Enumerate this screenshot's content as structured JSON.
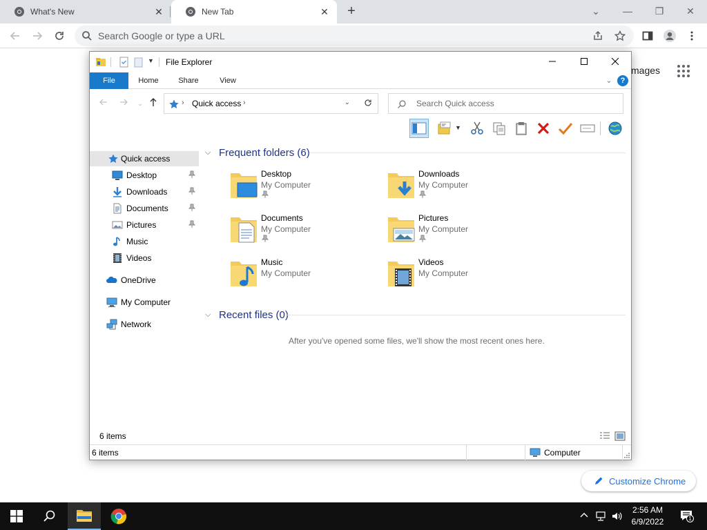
{
  "browser": {
    "tabs": [
      {
        "title": "What's New",
        "close": "✕"
      },
      {
        "title": "New Tab",
        "close": "✕"
      }
    ],
    "new_tab": "+",
    "window_controls": {
      "dropdown": "⌄",
      "minimize": "—",
      "restore": "❐",
      "close": "✕"
    },
    "omnibox_placeholder": "Search Google or type a URL",
    "images_link": "mages",
    "customize_label": "Customize Chrome",
    "accent_color": "#1a73e8"
  },
  "explorer": {
    "title": "File Explorer",
    "ribbon_tabs": [
      "File",
      "Home",
      "Share",
      "View"
    ],
    "help": "?",
    "address": {
      "location": "Quick access"
    },
    "search_placeholder": "Search Quick access",
    "nav_pane": {
      "quick_access": "Quick access",
      "pinned": [
        {
          "label": "Desktop",
          "icon": "desktop-icon",
          "pinned": true
        },
        {
          "label": "Downloads",
          "icon": "downloads-icon",
          "pinned": true
        },
        {
          "label": "Documents",
          "icon": "documents-icon",
          "pinned": true
        },
        {
          "label": "Pictures",
          "icon": "pictures-icon",
          "pinned": true
        },
        {
          "label": "Music",
          "icon": "music-icon",
          "pinned": false
        },
        {
          "label": "Videos",
          "icon": "videos-icon",
          "pinned": false
        }
      ],
      "onedrive": "OneDrive",
      "my_computer": "My Computer",
      "network": "Network"
    },
    "frequent_header": "Frequent folders (6)",
    "frequent_folders": [
      {
        "name": "Desktop",
        "location": "My Computer",
        "pinned": true
      },
      {
        "name": "Downloads",
        "location": "My Computer",
        "pinned": true
      },
      {
        "name": "Documents",
        "location": "My Computer",
        "pinned": true
      },
      {
        "name": "Pictures",
        "location": "My Computer",
        "pinned": true
      },
      {
        "name": "Music",
        "location": "My Computer",
        "pinned": false
      },
      {
        "name": "Videos",
        "location": "My Computer",
        "pinned": false
      }
    ],
    "recent_header": "Recent files (0)",
    "recent_empty": "After you've opened some files, we'll show the most recent ones here.",
    "item_count_inner": "6 items",
    "status_left": "6 items",
    "status_right": "Computer",
    "selection_color": "#cce8ff"
  },
  "taskbar": {
    "clock_time": "2:56 AM",
    "clock_date": "6/9/2022",
    "notification_count": "1"
  }
}
